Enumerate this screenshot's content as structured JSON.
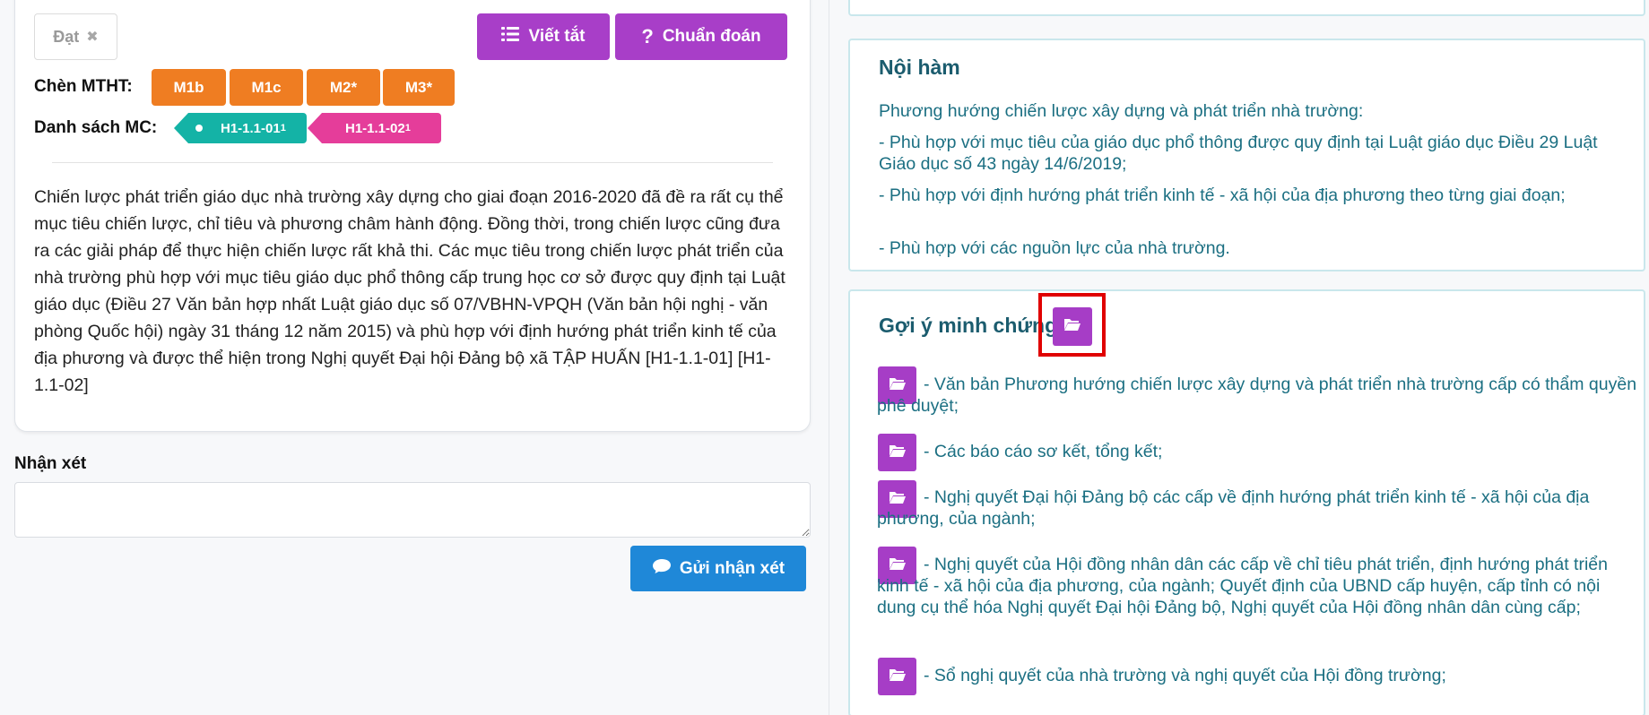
{
  "left": {
    "status_label": "Đạt",
    "status_close": "✖",
    "abbr_label": "Viết tắt",
    "diag_label": "Chuẩn đoán",
    "mtht_label": "Chèn MTHT:",
    "mtht_buttons": [
      "M1b",
      "M1c",
      "M2*",
      "M3*"
    ],
    "mc_label": "Danh sách MC:",
    "mc_tags": [
      {
        "code": "H1-1.1-01",
        "sub": "1"
      },
      {
        "code": "H1-1.1-02",
        "sub": "1"
      }
    ],
    "body_text": "Chiến lược phát triển giáo dục nhà trường xây dựng cho giai đoạn 2016-2020 đã đề ra rất cụ thể mục tiêu chiến lược, chỉ tiêu và phương châm hành động. Đồng thời, trong chiến lược cũng đưa ra các giải pháp để thực hiện chiến lược rất khả thi. Các mục tiêu trong chiến lược phát triển của nhà trường phù hợp với mục tiêu giáo dục phổ thông cấp trung học cơ sở được quy định tại Luật giáo dục (Điều 27 Văn bản hợp nhất Luật giáo dục số 07/VBHN-VPQH (Văn bản hội nghị - văn phòng Quốc hội) ngày 31 tháng 12 năm 2015) và phù hợp với định hướng phát triển kinh tế của địa phương và được thể hiện trong Nghị quyết Đại hội Đảng bộ xã TẬP HUẤN [H1-1.1-01] [H1-1.1-02]",
    "comment_label": "Nhận xét",
    "comment_value": "",
    "send_label": "Gửi nhận xét"
  },
  "noi_ham": {
    "title": "Nội hàm",
    "lines": [
      "Phương hướng chiến lược xây dựng và phát triển nhà trường:",
      "- Phù hợp với mục tiêu của giáo dục phổ thông được quy định tại Luật giáo dục Điều 29 Luật Giáo dục số 43 ngày 14/6/2019;",
      "- Phù hợp với định hướng phát triển kinh tế - xã hội của địa phương theo từng giai đoạn;",
      "- Phù hợp với các nguồn lực của nhà trường."
    ]
  },
  "goi_y": {
    "title": "Gợi ý minh chứng",
    "items": [
      "- Văn bản Phương hướng chiến lược xây dựng và phát triển nhà trường cấp có thẩm quyền phê duyệt;",
      "- Các báo cáo sơ kết, tổng kết;",
      "- Nghị quyết Đại hội Đảng bộ các cấp về định hướng phát triển kinh tế - xã hội của địa phương, của ngành;",
      "- Nghị quyết của Hội đồng nhân dân các cấp về chỉ tiêu phát triển, định hướng phát triển kinh tế - xã hội của địa phương, của ngành; Quyết định của UBND cấp huyện, cấp tỉnh có nội dung cụ thể hóa Nghị quyết Đại hội Đảng bộ, Nghị quyết của Hội đồng nhân dân cùng cấp;",
      "- Sổ nghị quyết của nhà trường và nghị quyết của Hội đồng trường;"
    ]
  },
  "colors": {
    "purple": "#a83ec8",
    "orange": "#ef7d22",
    "teal": "#14b3a6",
    "pink": "#e53d9a",
    "blue": "#1f88d8",
    "highlight": "#e00000"
  },
  "icons": [
    "close-icon",
    "list-icon",
    "question-icon",
    "comment-icon",
    "folder-open-icon"
  ]
}
